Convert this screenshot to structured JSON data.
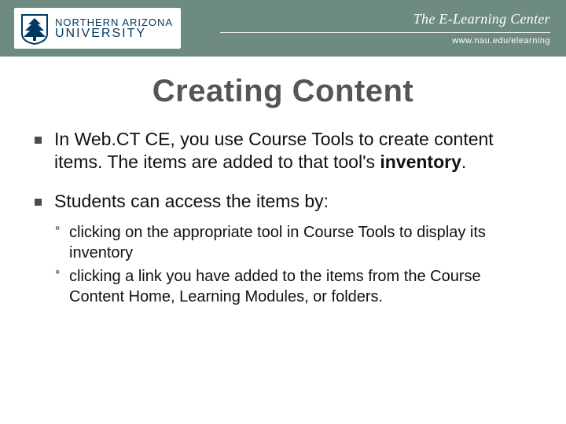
{
  "header": {
    "logo_line1": "NORTHERN ARIZONA",
    "logo_line2": "UNIVERSITY",
    "center_name": "The E-Learning Center",
    "url": "www.nau.edu/elearning"
  },
  "slide": {
    "title": "Creating Content",
    "bullets": [
      {
        "prefix": "In Web.CT CE, you use Course Tools to create content items. The items are added to that tool's ",
        "bold": "inventory",
        "suffix": "."
      },
      {
        "prefix": "Students can access the items by:",
        "bold": "",
        "suffix": ""
      }
    ],
    "subbullets": [
      "clicking on the appropriate tool in Course Tools to display its inventory",
      "clicking a link you have added to the items from the Course Content Home, Learning Modules, or folders."
    ]
  }
}
